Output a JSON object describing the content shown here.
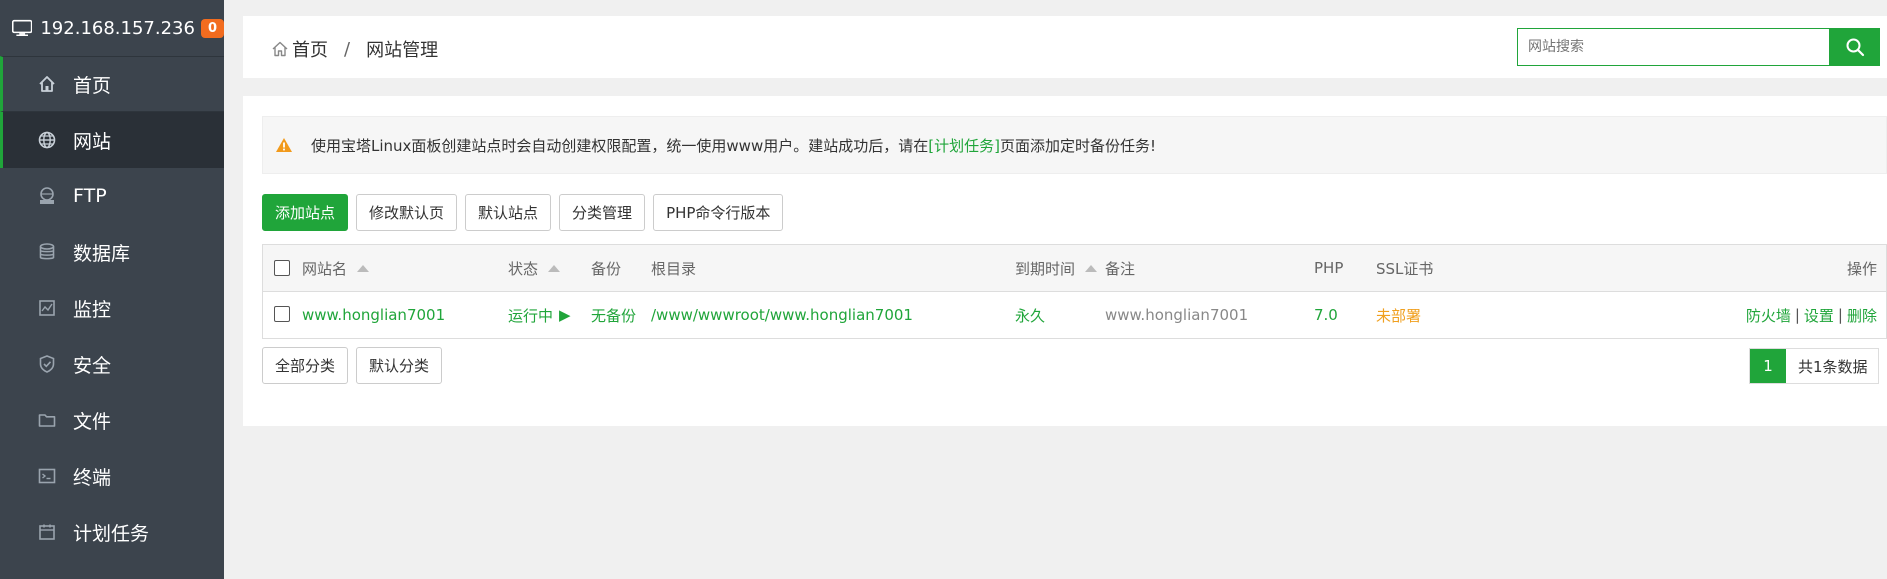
{
  "sidebar": {
    "server_ip": "192.168.157.236",
    "badge_count": "0",
    "items": [
      {
        "label": "首页",
        "icon": "home-icon"
      },
      {
        "label": "网站",
        "icon": "globe-icon"
      },
      {
        "label": "FTP",
        "icon": "ftp-icon"
      },
      {
        "label": "数据库",
        "icon": "database-icon"
      },
      {
        "label": "监控",
        "icon": "monitor-icon"
      },
      {
        "label": "安全",
        "icon": "shield-icon"
      },
      {
        "label": "文件",
        "icon": "folder-icon"
      },
      {
        "label": "终端",
        "icon": "terminal-icon"
      },
      {
        "label": "计划任务",
        "icon": "calendar-icon"
      }
    ]
  },
  "header": {
    "breadcrumb_home": "首页",
    "breadcrumb_sep": "/",
    "breadcrumb_current": "网站管理",
    "search_placeholder": "网站搜索"
  },
  "notice": {
    "text_before": "使用宝塔Linux面板创建站点时会自动创建权限配置，统一使用www用户。建站成功后，请在",
    "link": "[计划任务]",
    "text_after": "页面添加定时备份任务!"
  },
  "toolbar": {
    "add_site": "添加站点",
    "edit_default_page": "修改默认页",
    "default_site": "默认站点",
    "category_manage": "分类管理",
    "php_cli_version": "PHP命令行版本"
  },
  "table": {
    "headers": {
      "name": "网站名",
      "status": "状态",
      "backup": "备份",
      "root": "根目录",
      "expire": "到期时间",
      "remark": "备注",
      "php": "PHP",
      "ssl": "SSL证书",
      "ops": "操作"
    },
    "rows": [
      {
        "name": "www.honglian7001",
        "status": "运行中",
        "status_icon": "▶",
        "backup": "无备份",
        "root": "/www/wwwroot/www.honglian7001",
        "expire": "永久",
        "remark": "www.honglian7001",
        "php": "7.0",
        "ssl": "未部署",
        "op_firewall": "防火墙",
        "op_settings": "设置",
        "op_delete": "删除"
      }
    ]
  },
  "footer": {
    "all_categories": "全部分类",
    "default_category": "默认分类",
    "current_page": "1",
    "total": "共1条数据"
  },
  "colors": {
    "accent": "#20a53a",
    "sidebar_bg": "#3c444d",
    "badge": "#f26c1f",
    "ssl_warning": "#f0a020"
  }
}
